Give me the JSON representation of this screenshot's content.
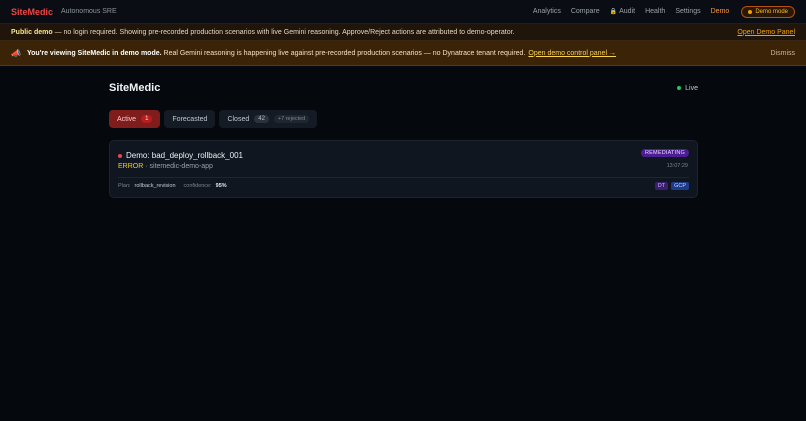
{
  "nav": {
    "brand": "SiteMedic",
    "tagline": "Autonomous SRE",
    "links": [
      "Analytics",
      "Compare",
      "Audit",
      "Health",
      "Settings",
      "Demo"
    ],
    "demo_mode": "Demo mode"
  },
  "banner_public": {
    "bold": "Public demo",
    "text": " — no login required. Showing pre-recorded production scenarios with live Gemini reasoning. Approve/Reject actions are attributed to demo-operator.",
    "link": "Open Demo Panel"
  },
  "banner_demo": {
    "bold": "You're viewing SiteMedic in demo mode.",
    "text": " Real Gemini reasoning is happening live against pre-recorded production scenarios — no Dynatrace tenant required.",
    "link": "Open demo control panel →",
    "dismiss": "Dismiss"
  },
  "page": {
    "title": "SiteMedic",
    "status": "Live"
  },
  "tabs": {
    "active": {
      "label": "Active",
      "count": "1"
    },
    "forecasted": {
      "label": "Forecasted"
    },
    "closed": {
      "label": "Closed",
      "count": "42",
      "sub": "+7 rejected"
    }
  },
  "incident": {
    "title": "Demo: bad_deploy_rollback_001",
    "severity": "ERROR",
    "separator": "·",
    "service": "sitemedic-demo-app",
    "status": "REMEDIATING",
    "time": "13:07:29",
    "plan_label": "Plan:",
    "plan_value": "rollback_revision",
    "confidence_label": "confidence:",
    "confidence_value": "95%",
    "tags": [
      "DT",
      "GCP"
    ]
  },
  "colors": {
    "brand": "#ef4444",
    "accent": "#f59e0b",
    "live": "#22c55e",
    "remediating": "#4c1d95"
  }
}
